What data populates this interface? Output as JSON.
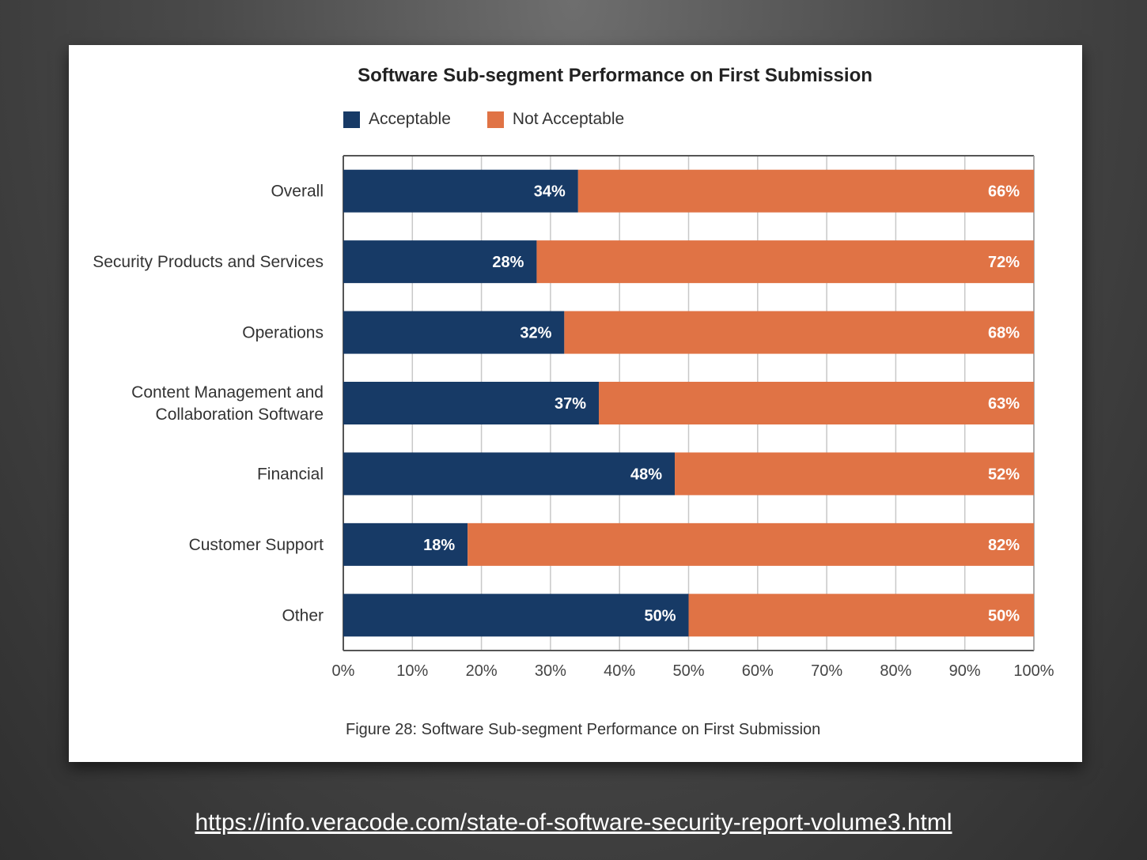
{
  "chart_data": {
    "type": "bar",
    "orientation": "horizontal",
    "stacked": true,
    "title": "Software Sub-segment Performance on First Submission",
    "caption": "Figure 28: Software Sub-segment Performance on First Submission",
    "categories": [
      [
        "Overall"
      ],
      [
        "Security Products and Services"
      ],
      [
        "Operations"
      ],
      [
        "Content Management and",
        "Collaboration Software"
      ],
      [
        "Financial"
      ],
      [
        "Customer Support"
      ],
      [
        "Other"
      ]
    ],
    "series": [
      {
        "name": "Acceptable",
        "color": "#173a66",
        "values": [
          34,
          28,
          32,
          37,
          48,
          18,
          50
        ]
      },
      {
        "name": "Not Acceptable",
        "color": "#e07345",
        "values": [
          66,
          72,
          68,
          63,
          52,
          82,
          50
        ]
      }
    ],
    "value_labels": {
      "Acceptable": [
        "34%",
        "28%",
        "32%",
        "37%",
        "48%",
        "18%",
        "50%"
      ],
      "Not Acceptable": [
        "66%",
        "72%",
        "68%",
        "63%",
        "52%",
        "82%",
        "50%"
      ]
    },
    "xlim": [
      0,
      100
    ],
    "xticks": [
      "0%",
      "10%",
      "20%",
      "30%",
      "40%",
      "50%",
      "60%",
      "70%",
      "80%",
      "90%",
      "100%"
    ],
    "grid": true,
    "legend_position": "top"
  },
  "source": {
    "url": "https://info.veracode.com/state-of-software-security-report-volume3.html"
  }
}
